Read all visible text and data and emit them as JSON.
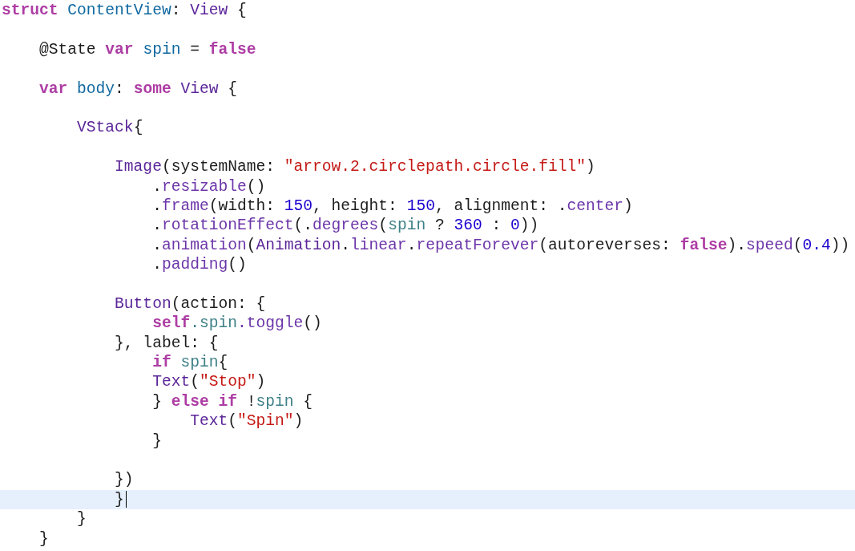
{
  "editor": {
    "lines": [
      {
        "kind": "code",
        "current": false,
        "tokens": [
          {
            "text": "struct",
            "kind": "keyword"
          },
          {
            "text": " ContentView",
            "kind": "decl"
          },
          {
            "text": ": ",
            "kind": "plain"
          },
          {
            "text": "View",
            "kind": "type"
          },
          {
            "text": " {",
            "kind": "plain"
          }
        ]
      },
      {
        "kind": "blank",
        "current": false
      },
      {
        "kind": "code",
        "current": false,
        "tokens": [
          {
            "text": "    @State ",
            "kind": "plain"
          },
          {
            "text": "var",
            "kind": "keyword"
          },
          {
            "text": " spin",
            "kind": "decl"
          },
          {
            "text": " = ",
            "kind": "plain"
          },
          {
            "text": "false",
            "kind": "keyword"
          }
        ]
      },
      {
        "kind": "blank",
        "current": false
      },
      {
        "kind": "code",
        "current": false,
        "tokens": [
          {
            "text": "    var",
            "kind": "keyword"
          },
          {
            "text": " body",
            "kind": "decl"
          },
          {
            "text": ": ",
            "kind": "plain"
          },
          {
            "text": "some",
            "kind": "keyword"
          },
          {
            "text": " View",
            "kind": "type"
          },
          {
            "text": " {",
            "kind": "plain"
          }
        ]
      },
      {
        "kind": "blank",
        "current": false
      },
      {
        "kind": "code",
        "current": false,
        "tokens": [
          {
            "text": "        VStack",
            "kind": "type"
          },
          {
            "text": "{",
            "kind": "plain"
          }
        ]
      },
      {
        "kind": "blank",
        "current": false
      },
      {
        "kind": "code",
        "current": false,
        "tokens": [
          {
            "text": "            Image",
            "kind": "type"
          },
          {
            "text": "(systemName: ",
            "kind": "plain"
          },
          {
            "text": "\"arrow.2.circlepath.circle.fill\"",
            "kind": "string"
          },
          {
            "text": ")",
            "kind": "plain"
          }
        ]
      },
      {
        "kind": "code",
        "current": false,
        "tokens": [
          {
            "text": "                .",
            "kind": "plain"
          },
          {
            "text": "resizable",
            "kind": "method"
          },
          {
            "text": "()",
            "kind": "plain"
          }
        ]
      },
      {
        "kind": "code",
        "current": false,
        "tokens": [
          {
            "text": "                .",
            "kind": "plain"
          },
          {
            "text": "frame",
            "kind": "method"
          },
          {
            "text": "(width: ",
            "kind": "plain"
          },
          {
            "text": "150",
            "kind": "number"
          },
          {
            "text": ", height: ",
            "kind": "plain"
          },
          {
            "text": "150",
            "kind": "number"
          },
          {
            "text": ", alignment: .",
            "kind": "plain"
          },
          {
            "text": "center",
            "kind": "method"
          },
          {
            "text": ")",
            "kind": "plain"
          }
        ]
      },
      {
        "kind": "code",
        "current": false,
        "tokens": [
          {
            "text": "                .",
            "kind": "plain"
          },
          {
            "text": "rotationEffect",
            "kind": "method"
          },
          {
            "text": "(.",
            "kind": "plain"
          },
          {
            "text": "degrees",
            "kind": "method"
          },
          {
            "text": "(",
            "kind": "plain"
          },
          {
            "text": "spin",
            "kind": "property"
          },
          {
            "text": " ? ",
            "kind": "plain"
          },
          {
            "text": "360",
            "kind": "number"
          },
          {
            "text": " : ",
            "kind": "plain"
          },
          {
            "text": "0",
            "kind": "number"
          },
          {
            "text": "))",
            "kind": "plain"
          }
        ]
      },
      {
        "kind": "code",
        "current": false,
        "tokens": [
          {
            "text": "                .",
            "kind": "plain"
          },
          {
            "text": "animation",
            "kind": "method"
          },
          {
            "text": "(",
            "kind": "plain"
          },
          {
            "text": "Animation",
            "kind": "type"
          },
          {
            "text": ".",
            "kind": "plain"
          },
          {
            "text": "linear",
            "kind": "method"
          },
          {
            "text": ".",
            "kind": "plain"
          },
          {
            "text": "repeatForever",
            "kind": "method"
          },
          {
            "text": "(autoreverses: ",
            "kind": "plain"
          },
          {
            "text": "false",
            "kind": "keyword"
          },
          {
            "text": ").",
            "kind": "plain"
          },
          {
            "text": "speed",
            "kind": "method"
          },
          {
            "text": "(",
            "kind": "plain"
          },
          {
            "text": "0.4",
            "kind": "number"
          },
          {
            "text": "))",
            "kind": "plain"
          }
        ]
      },
      {
        "kind": "code",
        "current": false,
        "tokens": [
          {
            "text": "                .",
            "kind": "plain"
          },
          {
            "text": "padding",
            "kind": "method"
          },
          {
            "text": "()",
            "kind": "plain"
          }
        ]
      },
      {
        "kind": "blank",
        "current": false
      },
      {
        "kind": "code",
        "current": false,
        "tokens": [
          {
            "text": "            Button",
            "kind": "type"
          },
          {
            "text": "(action: {",
            "kind": "plain"
          }
        ]
      },
      {
        "kind": "code",
        "current": false,
        "tokens": [
          {
            "text": "                self",
            "kind": "keyword"
          },
          {
            "text": ".spin",
            "kind": "property"
          },
          {
            "text": ".toggle",
            "kind": "method"
          },
          {
            "text": "()",
            "kind": "plain"
          }
        ]
      },
      {
        "kind": "code",
        "current": false,
        "tokens": [
          {
            "text": "            }, label: {",
            "kind": "plain"
          }
        ]
      },
      {
        "kind": "code",
        "current": false,
        "tokens": [
          {
            "text": "                if",
            "kind": "keyword"
          },
          {
            "text": " spin",
            "kind": "property"
          },
          {
            "text": "{",
            "kind": "plain"
          }
        ]
      },
      {
        "kind": "code",
        "current": false,
        "tokens": [
          {
            "text": "                Text",
            "kind": "type"
          },
          {
            "text": "(",
            "kind": "plain"
          },
          {
            "text": "\"Stop\"",
            "kind": "string"
          },
          {
            "text": ")",
            "kind": "plain"
          }
        ]
      },
      {
        "kind": "code",
        "current": false,
        "tokens": [
          {
            "text": "                } ",
            "kind": "plain"
          },
          {
            "text": "else",
            "kind": "keyword"
          },
          {
            "text": " if",
            "kind": "keyword"
          },
          {
            "text": " !",
            "kind": "plain"
          },
          {
            "text": "spin",
            "kind": "property"
          },
          {
            "text": " {",
            "kind": "plain"
          }
        ]
      },
      {
        "kind": "code",
        "current": false,
        "tokens": [
          {
            "text": "                    Text",
            "kind": "type"
          },
          {
            "text": "(",
            "kind": "plain"
          },
          {
            "text": "\"Spin\"",
            "kind": "string"
          },
          {
            "text": ")",
            "kind": "plain"
          }
        ]
      },
      {
        "kind": "code",
        "current": false,
        "tokens": [
          {
            "text": "                }",
            "kind": "plain"
          }
        ]
      },
      {
        "kind": "blank",
        "current": false
      },
      {
        "kind": "code",
        "current": false,
        "tokens": [
          {
            "text": "            })",
            "kind": "plain"
          }
        ]
      },
      {
        "kind": "code",
        "current": true,
        "tokens": [
          {
            "text": "            }",
            "kind": "plain"
          }
        ]
      },
      {
        "kind": "code",
        "current": false,
        "tokens": [
          {
            "text": "        }",
            "kind": "plain"
          }
        ]
      },
      {
        "kind": "code",
        "current": false,
        "tokens": [
          {
            "text": "    }",
            "kind": "plain"
          }
        ]
      }
    ]
  }
}
